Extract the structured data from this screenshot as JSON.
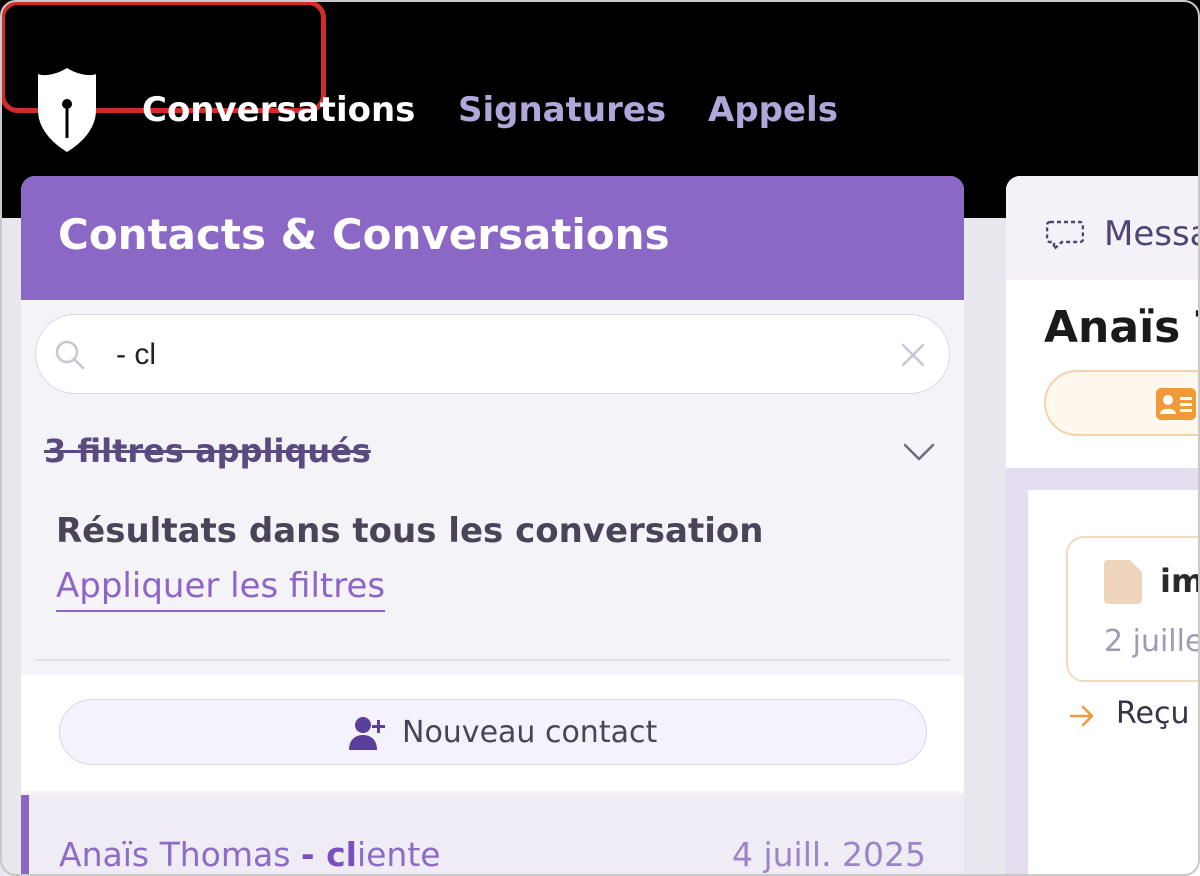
{
  "nav": {
    "items": [
      {
        "label": "Conversations",
        "active": true
      },
      {
        "label": "Signatures",
        "active": false
      },
      {
        "label": "Appels",
        "active": false
      }
    ]
  },
  "panel": {
    "title": "Contacts & Conversations",
    "search": {
      "value": "- cl",
      "placeholder": ""
    },
    "filters_label": "3 filtres appliqués",
    "results_title": "Résultats dans tous les conversation",
    "apply_filters": "Appliquer les filtres",
    "new_contact": "Nouveau contact",
    "conversations": [
      {
        "name": "Anaïs Thomas ",
        "match_prefix": "- cl",
        "match_rest": "iente",
        "date": "4 juill. 2025"
      }
    ]
  },
  "right": {
    "tab_label": "Messa",
    "contact_name": "Anaïs T",
    "card_title": "im",
    "card_date": "2 juille",
    "received_label": "Reçu"
  },
  "colors": {
    "brand": "#8b68c6",
    "active_outline": "#d32a2a",
    "nav_inactive": "#b0a6d9",
    "accent_orange": "#f29a3a"
  }
}
